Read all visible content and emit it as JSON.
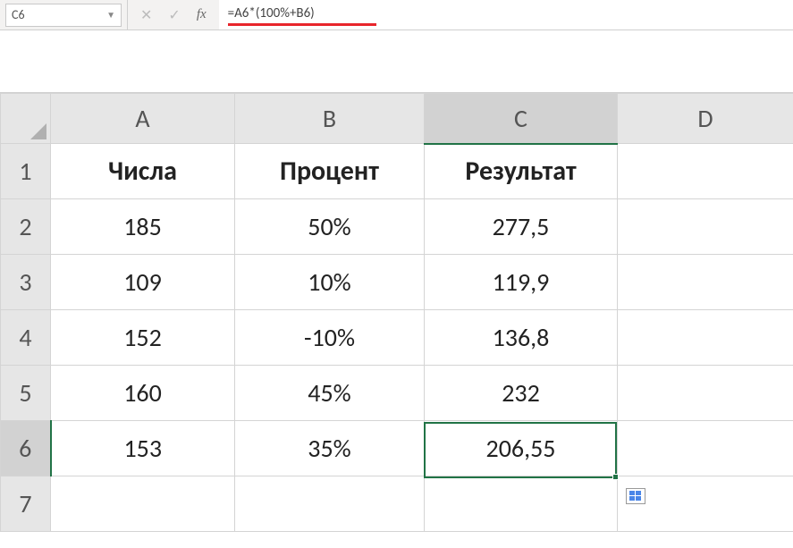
{
  "nameBox": {
    "value": "C6"
  },
  "formulaBar": {
    "cancelIcon": "✕",
    "confirmIcon": "✓",
    "fxLabel": "fx",
    "formula": "=A6*(100%+B6)"
  },
  "columns": [
    "A",
    "B",
    "C",
    "D"
  ],
  "rowNumbers": [
    "1",
    "2",
    "3",
    "4",
    "5",
    "6",
    "7"
  ],
  "headers": {
    "A": "Числа",
    "B": "Процент",
    "C": "Результат"
  },
  "rows": [
    {
      "A": "185",
      "B": "50%",
      "C": "277,5"
    },
    {
      "A": "109",
      "B": "10%",
      "C": "119,9"
    },
    {
      "A": "152",
      "B": "-10%",
      "C": "136,8"
    },
    {
      "A": "160",
      "B": "45%",
      "C": "232"
    },
    {
      "A": "153",
      "B": "35%",
      "C": "206,55"
    }
  ],
  "selectedCell": "C6",
  "selectedColumn": "C",
  "selectedRow": "6"
}
